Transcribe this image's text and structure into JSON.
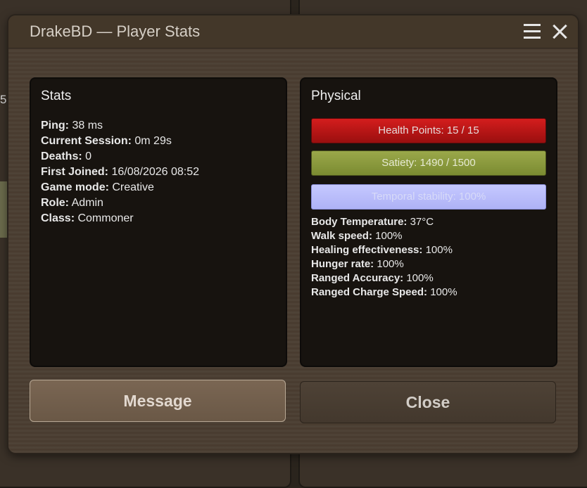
{
  "background": {
    "edge_number": "5",
    "edge_paren": ")"
  },
  "dialog": {
    "title": "DrakeBD — Player Stats"
  },
  "stats_panel": {
    "title": "Stats",
    "rows": [
      {
        "label": "Ping:",
        "value": " 38 ms"
      },
      {
        "label": "Current Session:",
        "value": " 0m 29s"
      },
      {
        "label": "Deaths:",
        "value": " 0"
      },
      {
        "label": "First Joined:",
        "value": " 16/08/2026 08:52"
      },
      {
        "label": "Game mode:",
        "value": " Creative"
      },
      {
        "label": "Role:",
        "value": " Admin"
      },
      {
        "label": "Class:",
        "value": " Commoner"
      }
    ]
  },
  "physical_panel": {
    "title": "Physical",
    "bars": {
      "health": "Health Points: 15 / 15",
      "satiety": "Satiety: 1490 / 1500",
      "temporal": "Temporal stability: 100%"
    },
    "rows": [
      {
        "label": "Body Temperature:",
        "value": " 37°C"
      },
      {
        "label": "Walk speed:",
        "value": " 100%"
      },
      {
        "label": "Healing effectiveness:",
        "value": " 100%"
      },
      {
        "label": "Hunger rate:",
        "value": " 100%"
      },
      {
        "label": "Ranged Accuracy:",
        "value": " 100%"
      },
      {
        "label": "Ranged Charge Speed:",
        "value": " 100%"
      }
    ]
  },
  "buttons": {
    "message": "Message",
    "close": "Close"
  },
  "colors": {
    "health": "#d41d1d",
    "satiety": "#9aa84a",
    "temporal": "#c5c8ff"
  }
}
